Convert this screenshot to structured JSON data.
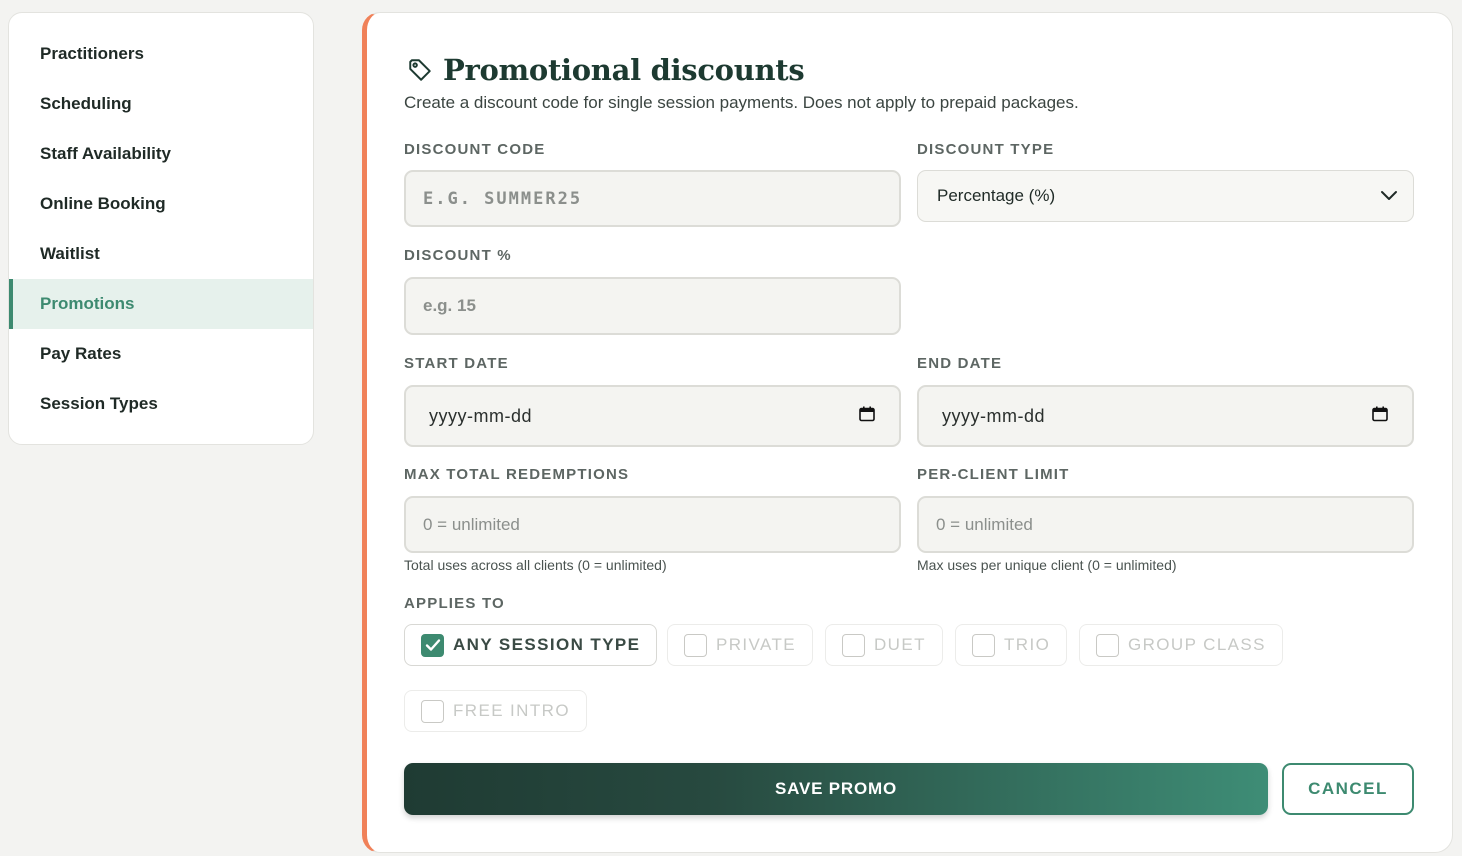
{
  "sidebar": {
    "items": [
      {
        "label": "Practitioners"
      },
      {
        "label": "Scheduling"
      },
      {
        "label": "Staff Availability"
      },
      {
        "label": "Online Booking"
      },
      {
        "label": "Waitlist"
      },
      {
        "label": "Promotions"
      },
      {
        "label": "Pay Rates"
      },
      {
        "label": "Session Types"
      }
    ],
    "active": "Promotions"
  },
  "card": {
    "title": "Promotional discounts",
    "subtitle": "Create a discount code for single session payments. Does not apply to prepaid packages.",
    "icon": "tag-icon",
    "accent_color": "#f08159"
  },
  "form": {
    "discount_code": {
      "label": "DISCOUNT CODE",
      "placeholder": "E.G. SUMMER25",
      "value": ""
    },
    "discount_type": {
      "label": "DISCOUNT TYPE",
      "value": "Percentage (%)"
    },
    "discount_pct": {
      "label": "DISCOUNT %",
      "placeholder": "e.g. 15",
      "value": ""
    },
    "start_date": {
      "label": "START DATE",
      "placeholder": "yyyy-mm-dd"
    },
    "end_date": {
      "label": "END DATE",
      "placeholder": "yyyy-mm-dd"
    },
    "max_total": {
      "label": "MAX TOTAL REDEMPTIONS",
      "placeholder": "0 = unlimited",
      "help": "Total uses across all clients (0 = unlimited)"
    },
    "per_client": {
      "label": "PER-CLIENT LIMIT",
      "placeholder": "0 = unlimited",
      "help": "Max uses per unique client (0 = unlimited)"
    },
    "applies_to": {
      "label": "APPLIES TO",
      "options": [
        {
          "label": "ANY SESSION TYPE",
          "checked": true
        },
        {
          "label": "PRIVATE",
          "checked": false
        },
        {
          "label": "DUET",
          "checked": false
        },
        {
          "label": "TRIO",
          "checked": false
        },
        {
          "label": "GROUP CLASS",
          "checked": false
        },
        {
          "label": "FREE INTRO",
          "checked": false
        }
      ]
    }
  },
  "actions": {
    "save_label": "SAVE PROMO",
    "cancel_label": "CANCEL"
  },
  "colors": {
    "brand_green": "#3d8a70",
    "dark_green": "#1f3b33",
    "active_bg": "#e6f1ec"
  }
}
